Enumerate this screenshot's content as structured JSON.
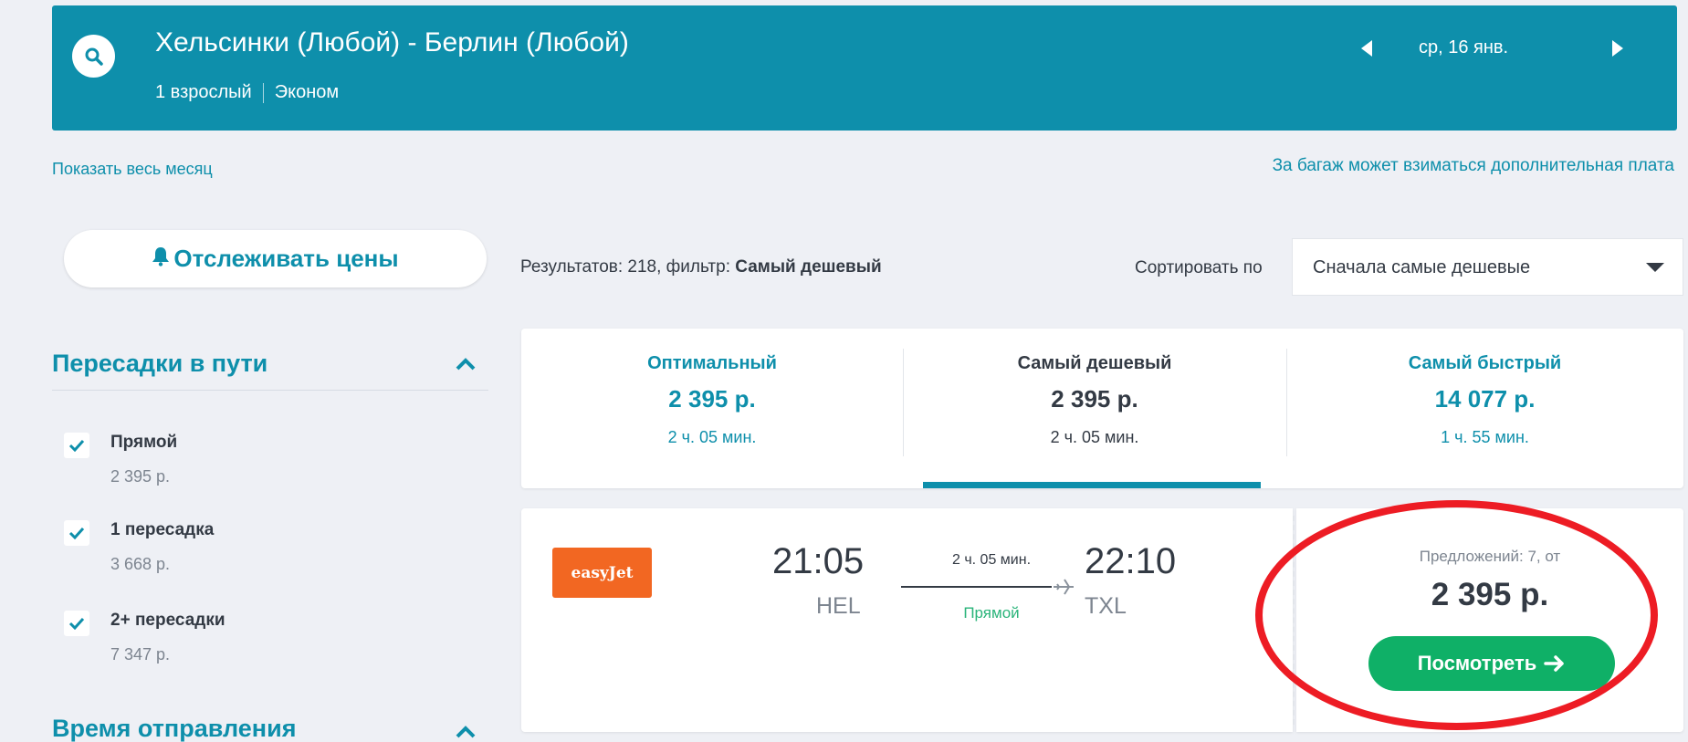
{
  "header": {
    "route": "Хельсинки (Любой) - Берлин (Любой)",
    "passengers": "1 взрослый",
    "cabin": "Эконом",
    "date": "ср, 16 янв."
  },
  "links": {
    "show_month": "Показать весь месяц",
    "baggage_note": "За багаж может взиматься дополнительная плата"
  },
  "sidebar": {
    "track_prices_label": "Отслеживать цены",
    "stops_title": "Пересадки в пути",
    "stops": [
      {
        "label": "Прямой",
        "price": "2 395 р.",
        "checked": true
      },
      {
        "label": "1 пересадка",
        "price": "3 668 р.",
        "checked": true
      },
      {
        "label": "2+ пересадки",
        "price": "7 347 р.",
        "checked": true
      }
    ],
    "departure_title": "Время отправления"
  },
  "results": {
    "info_prefix": "Результатов: 218, фильтр: ",
    "info_filter": "Самый дешевый",
    "sort_label": "Сортировать по",
    "sort_value": "Сначала самые дешевые"
  },
  "tabs": [
    {
      "title": "Оптимальный",
      "price": "2 395 р.",
      "duration": "2 ч. 05 мин."
    },
    {
      "title": "Самый дешевый",
      "price": "2 395 р.",
      "duration": "2 ч. 05 мин."
    },
    {
      "title": "Самый быстрый",
      "price": "14 077 р.",
      "duration": "1 ч. 55 мин."
    }
  ],
  "active_tab": 1,
  "flight": {
    "airline": "easyJet",
    "departure_time": "21:05",
    "departure_airport": "HEL",
    "duration": "2 ч. 05 мин.",
    "stops": "Прямой",
    "arrival_time": "22:10",
    "arrival_airport": "TXL",
    "offers": "Предложений: 7, от",
    "price": "2 395 р.",
    "view_label": "Посмотреть"
  },
  "colors": {
    "brand_teal": "#0e8fab",
    "success_green": "#0fb067",
    "direct_green": "#2ab47a",
    "airline_orange": "#f26722",
    "annotation_red": "#ed1c24"
  }
}
